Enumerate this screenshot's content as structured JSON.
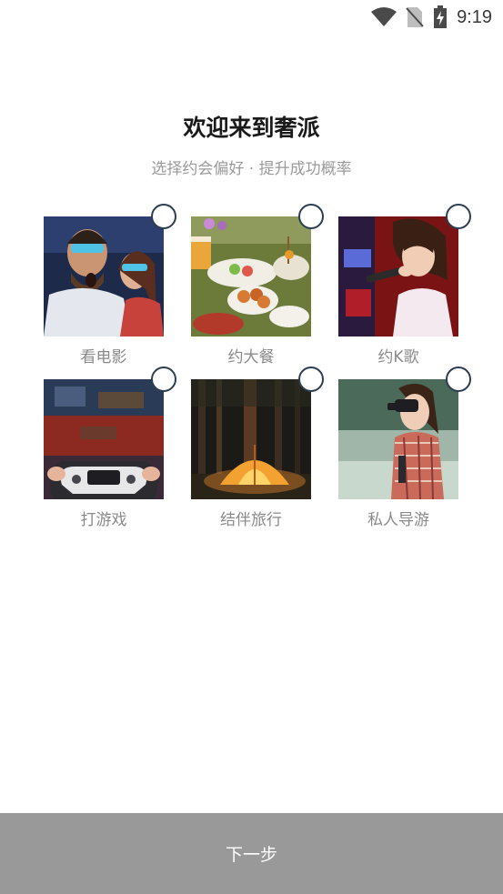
{
  "status_bar": {
    "time": "9:19",
    "icons": [
      "wifi-icon",
      "no-sim-icon",
      "battery-charging-icon"
    ]
  },
  "page": {
    "title": "欢迎来到奢派",
    "subtitle": "选择约会偏好 · 提升成功概率"
  },
  "preferences": [
    {
      "label": "看电影",
      "selected": false,
      "image": "movie-audience-3d-glasses"
    },
    {
      "label": "约大餐",
      "selected": false,
      "image": "dinner-table-dishes"
    },
    {
      "label": "约K歌",
      "selected": false,
      "image": "woman-singing-karaoke"
    },
    {
      "label": "打游戏",
      "selected": false,
      "image": "game-controller"
    },
    {
      "label": "结伴旅行",
      "selected": false,
      "image": "tent-in-forest"
    },
    {
      "label": "私人导游",
      "selected": false,
      "image": "woman-with-binoculars"
    }
  ],
  "footer": {
    "next_label": "下一步"
  },
  "colors": {
    "title": "#1a1a1a",
    "subtitle": "#9a9a9a",
    "label": "#8a8a8a",
    "checkbox_border": "#2c3e4f",
    "next_bar": "#999999"
  }
}
